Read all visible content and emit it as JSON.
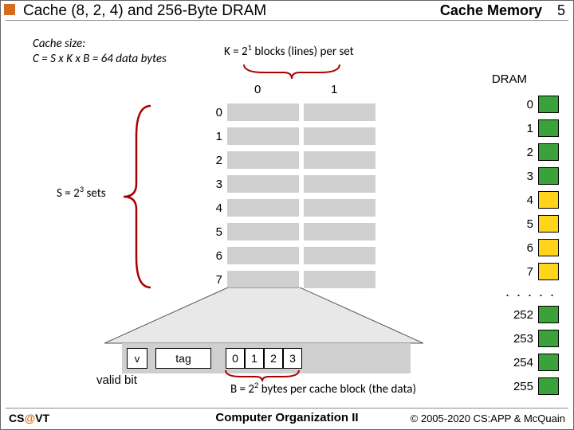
{
  "header": {
    "title": "Cache (8, 2, 4) and 256-Byte DRAM",
    "section": "Cache Memory",
    "page": "5"
  },
  "cache_size_label": "Cache size:",
  "cache_size_formula": "C = S x K x B = 64 data bytes",
  "k_label_pre": "K = 2",
  "k_exp": "1",
  "k_label_post": " blocks (lines) per set",
  "s_label_pre": "S = 2",
  "s_exp": "3",
  "s_label_post": " sets",
  "b_label_pre": "B = 2",
  "b_exp": "2",
  "b_label_post": " bytes per cache block (the data)",
  "dram_label": "DRAM",
  "cache_col0": "0",
  "cache_col1": "1",
  "cache_rows": [
    "0",
    "1",
    "2",
    "3",
    "4",
    "5",
    "6",
    "7"
  ],
  "dram_top": [
    "0",
    "1",
    "2",
    "3",
    "4",
    "5",
    "6",
    "7"
  ],
  "dram_dots": ". . . . .",
  "dram_bottom": [
    "252",
    "253",
    "254",
    "255"
  ],
  "zoom": {
    "v": "v",
    "tag": "tag",
    "bytes": [
      "0",
      "1",
      "2",
      "3"
    ]
  },
  "valid_label": "valid bit",
  "footer": {
    "left_a": "CS",
    "left_b": "@",
    "left_c": "VT",
    "center": "Computer Organization II",
    "right": "© 2005-2020 CS:APP & McQuain"
  }
}
